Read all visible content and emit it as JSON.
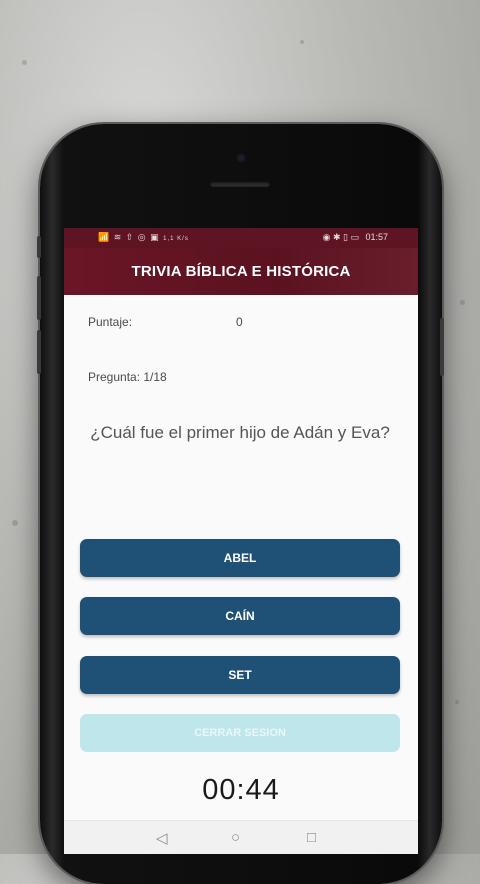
{
  "status_bar": {
    "left_icons": "📶 ≋ ⇧ ◎ ▣",
    "speed": "1,1 K/s",
    "right_icons": "◉ ✱ ▯ ▭",
    "time": "01:57"
  },
  "app_bar": {
    "title": "TRIVIA BÍBLICA E HISTÓRICA"
  },
  "score": {
    "label": "Puntaje:",
    "value": "0"
  },
  "progress": {
    "text": "Pregunta: 1/18"
  },
  "question": {
    "text": "¿Cuál fue el primer hijo de Adán y Eva?"
  },
  "answers": [
    {
      "label": "ABEL"
    },
    {
      "label": "CAÍN"
    },
    {
      "label": "SET"
    }
  ],
  "logout": {
    "label": "CERRAR SESION"
  },
  "timer": {
    "value": "00:44"
  },
  "nav": {
    "back": "◁",
    "home": "○",
    "recents": "□"
  },
  "colors": {
    "app_bar": "#5e1422",
    "answer_button": "#1f5177",
    "logout_button": "#bfe6ea"
  }
}
